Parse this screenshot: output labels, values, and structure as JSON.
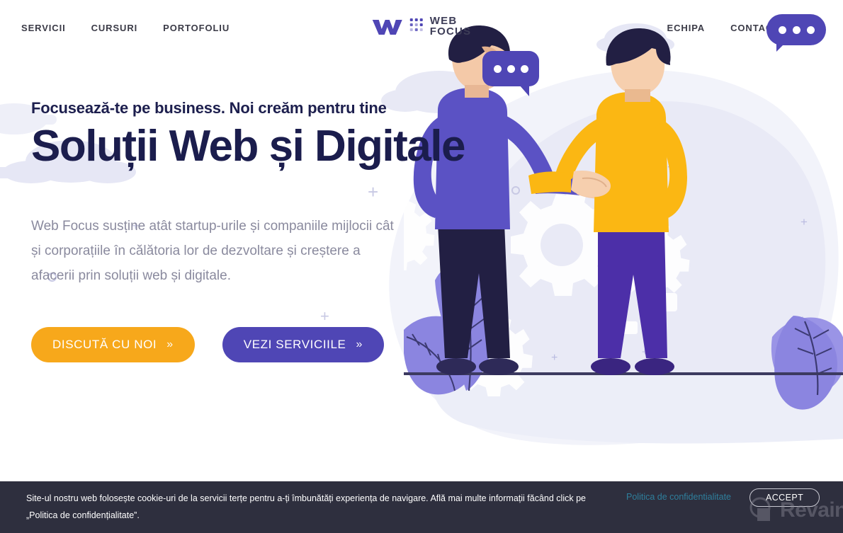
{
  "site": {
    "brand": "WEB FOCUS",
    "brand_line1": "WEB",
    "brand_line2": "FOCUS"
  },
  "header": {
    "nav_left": [
      {
        "label": "SERVICII",
        "name": "nav-item-servicii"
      },
      {
        "label": "CURSURI",
        "name": "nav-item-cursuri"
      },
      {
        "label": "PORTOFOLIU",
        "name": "nav-item-portofoliu"
      }
    ],
    "nav_right": [
      {
        "label": "ECHIPA",
        "name": "nav-item-echipa"
      },
      {
        "label": "CONTACT",
        "name": "nav-item-contact"
      }
    ],
    "search_icon": "search-icon",
    "chat_icon": "chat-bubble-icon"
  },
  "hero": {
    "kicker": "Focusează-te pe business. Noi creăm pentru tine",
    "title": "Soluții Web și Digitale",
    "paragraph": "Web Focus susține atât startup-urile și companiile mijlocii cât și corporațiile în călătoria lor de dezvoltare și creștere a afacerii prin soluții web și digitale.",
    "cta_primary": "DISCUTĂ CU NOI",
    "cta_primary_chevron": "»",
    "cta_secondary": "VEZI SERVICIILE",
    "cta_secondary_chevron": "»"
  },
  "illustration": {
    "alt": "two businessmen shaking hands with gears and plants background"
  },
  "cookie_banner": {
    "text": "Site-ul nostru web folosește cookie-uri de la servicii terțe pentru a-ți îmbunătăți experiența de navigare. Află mai multe informații făcând click pe „Politica de confidențialitate”.",
    "link_label": "Politica de confidentialitate",
    "accept_label": "ACCEPT"
  },
  "watermark": {
    "text": "Revain"
  },
  "colors": {
    "purple": "#4f46b5",
    "orange": "#f7a81b",
    "navy": "#1b1d4d",
    "dark_banner": "#2e2f3e",
    "link_teal": "#2e7f9c",
    "lavender": "#e6e7f5",
    "body_text": "#8a8a9e"
  }
}
